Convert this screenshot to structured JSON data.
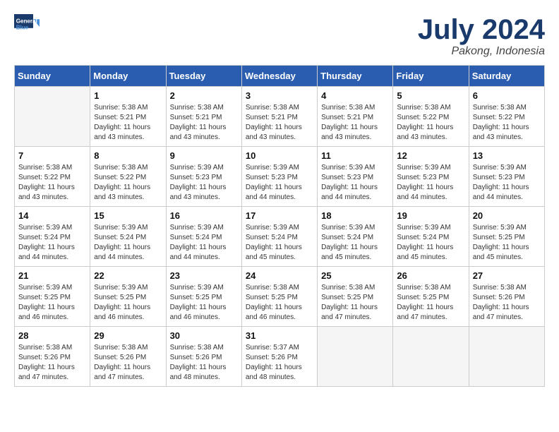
{
  "header": {
    "logo_line1": "General",
    "logo_line2": "Blue",
    "month_title": "July 2024",
    "location": "Pakong, Indonesia"
  },
  "weekdays": [
    "Sunday",
    "Monday",
    "Tuesday",
    "Wednesday",
    "Thursday",
    "Friday",
    "Saturday"
  ],
  "weeks": [
    [
      {
        "day": "",
        "empty": true
      },
      {
        "day": "1",
        "sunrise": "5:38 AM",
        "sunset": "5:21 PM",
        "daylight": "11 hours and 43 minutes."
      },
      {
        "day": "2",
        "sunrise": "5:38 AM",
        "sunset": "5:21 PM",
        "daylight": "11 hours and 43 minutes."
      },
      {
        "day": "3",
        "sunrise": "5:38 AM",
        "sunset": "5:21 PM",
        "daylight": "11 hours and 43 minutes."
      },
      {
        "day": "4",
        "sunrise": "5:38 AM",
        "sunset": "5:21 PM",
        "daylight": "11 hours and 43 minutes."
      },
      {
        "day": "5",
        "sunrise": "5:38 AM",
        "sunset": "5:22 PM",
        "daylight": "11 hours and 43 minutes."
      },
      {
        "day": "6",
        "sunrise": "5:38 AM",
        "sunset": "5:22 PM",
        "daylight": "11 hours and 43 minutes."
      }
    ],
    [
      {
        "day": "7",
        "sunrise": "5:38 AM",
        "sunset": "5:22 PM",
        "daylight": "11 hours and 43 minutes."
      },
      {
        "day": "8",
        "sunrise": "5:38 AM",
        "sunset": "5:22 PM",
        "daylight": "11 hours and 43 minutes."
      },
      {
        "day": "9",
        "sunrise": "5:39 AM",
        "sunset": "5:23 PM",
        "daylight": "11 hours and 43 minutes."
      },
      {
        "day": "10",
        "sunrise": "5:39 AM",
        "sunset": "5:23 PM",
        "daylight": "11 hours and 44 minutes."
      },
      {
        "day": "11",
        "sunrise": "5:39 AM",
        "sunset": "5:23 PM",
        "daylight": "11 hours and 44 minutes."
      },
      {
        "day": "12",
        "sunrise": "5:39 AM",
        "sunset": "5:23 PM",
        "daylight": "11 hours and 44 minutes."
      },
      {
        "day": "13",
        "sunrise": "5:39 AM",
        "sunset": "5:23 PM",
        "daylight": "11 hours and 44 minutes."
      }
    ],
    [
      {
        "day": "14",
        "sunrise": "5:39 AM",
        "sunset": "5:24 PM",
        "daylight": "11 hours and 44 minutes."
      },
      {
        "day": "15",
        "sunrise": "5:39 AM",
        "sunset": "5:24 PM",
        "daylight": "11 hours and 44 minutes."
      },
      {
        "day": "16",
        "sunrise": "5:39 AM",
        "sunset": "5:24 PM",
        "daylight": "11 hours and 44 minutes."
      },
      {
        "day": "17",
        "sunrise": "5:39 AM",
        "sunset": "5:24 PM",
        "daylight": "11 hours and 45 minutes."
      },
      {
        "day": "18",
        "sunrise": "5:39 AM",
        "sunset": "5:24 PM",
        "daylight": "11 hours and 45 minutes."
      },
      {
        "day": "19",
        "sunrise": "5:39 AM",
        "sunset": "5:24 PM",
        "daylight": "11 hours and 45 minutes."
      },
      {
        "day": "20",
        "sunrise": "5:39 AM",
        "sunset": "5:25 PM",
        "daylight": "11 hours and 45 minutes."
      }
    ],
    [
      {
        "day": "21",
        "sunrise": "5:39 AM",
        "sunset": "5:25 PM",
        "daylight": "11 hours and 46 minutes."
      },
      {
        "day": "22",
        "sunrise": "5:39 AM",
        "sunset": "5:25 PM",
        "daylight": "11 hours and 46 minutes."
      },
      {
        "day": "23",
        "sunrise": "5:39 AM",
        "sunset": "5:25 PM",
        "daylight": "11 hours and 46 minutes."
      },
      {
        "day": "24",
        "sunrise": "5:38 AM",
        "sunset": "5:25 PM",
        "daylight": "11 hours and 46 minutes."
      },
      {
        "day": "25",
        "sunrise": "5:38 AM",
        "sunset": "5:25 PM",
        "daylight": "11 hours and 47 minutes."
      },
      {
        "day": "26",
        "sunrise": "5:38 AM",
        "sunset": "5:25 PM",
        "daylight": "11 hours and 47 minutes."
      },
      {
        "day": "27",
        "sunrise": "5:38 AM",
        "sunset": "5:26 PM",
        "daylight": "11 hours and 47 minutes."
      }
    ],
    [
      {
        "day": "28",
        "sunrise": "5:38 AM",
        "sunset": "5:26 PM",
        "daylight": "11 hours and 47 minutes."
      },
      {
        "day": "29",
        "sunrise": "5:38 AM",
        "sunset": "5:26 PM",
        "daylight": "11 hours and 47 minutes."
      },
      {
        "day": "30",
        "sunrise": "5:38 AM",
        "sunset": "5:26 PM",
        "daylight": "11 hours and 48 minutes."
      },
      {
        "day": "31",
        "sunrise": "5:37 AM",
        "sunset": "5:26 PM",
        "daylight": "11 hours and 48 minutes."
      },
      {
        "day": "",
        "empty": true
      },
      {
        "day": "",
        "empty": true
      },
      {
        "day": "",
        "empty": true
      }
    ]
  ]
}
